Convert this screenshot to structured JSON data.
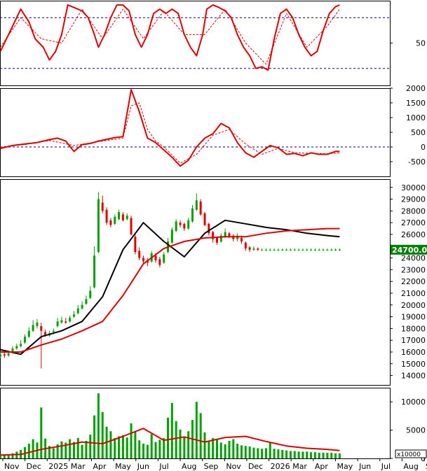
{
  "chart_data": [
    {
      "type": "line",
      "panel": "oscillator",
      "ytick_labels": [
        {
          "value": 50,
          "label": "50"
        }
      ],
      "ylim": [
        0,
        100
      ],
      "reference_levels": [
        80,
        20
      ],
      "series": [
        {
          "color": "#dd0000",
          "style": "solid",
          "x": [
            0,
            6,
            10,
            14,
            17,
            21,
            24,
            27,
            30,
            33,
            36,
            40,
            43,
            46,
            48,
            51,
            54,
            57,
            60,
            63,
            66,
            69,
            72,
            75,
            78,
            81,
            84,
            87,
            90,
            93,
            96,
            99,
            101,
            104,
            107,
            110,
            113,
            116,
            119,
            122,
            125,
            128,
            131,
            134,
            137,
            140,
            143,
            146,
            149,
            152,
            155,
            158,
            161,
            164,
            166
          ],
          "y": [
            40,
            70,
            90,
            75,
            55,
            45,
            30,
            40,
            60,
            95,
            92,
            88,
            80,
            60,
            45,
            60,
            80,
            95,
            95,
            88,
            60,
            45,
            60,
            85,
            90,
            85,
            90,
            85,
            60,
            45,
            35,
            60,
            90,
            95,
            92,
            88,
            80,
            60,
            45,
            35,
            20,
            22,
            18,
            55,
            85,
            90,
            80,
            60,
            45,
            35,
            40,
            65,
            85,
            93,
            95
          ]
        },
        {
          "color": "#dd0000",
          "style": "dashed",
          "x": [
            0,
            10,
            20,
            30,
            40,
            50,
            60,
            70,
            80,
            90,
            100,
            110,
            120,
            130,
            140,
            150,
            160,
            166
          ],
          "y": [
            45,
            80,
            55,
            50,
            90,
            55,
            90,
            55,
            88,
            60,
            60,
            90,
            50,
            25,
            85,
            45,
            70,
            90
          ]
        }
      ]
    },
    {
      "type": "line",
      "panel": "momentum",
      "ytick_labels": [
        {
          "value": 2000,
          "label": "2000"
        },
        {
          "value": 1500,
          "label": "1500"
        },
        {
          "value": 1000,
          "label": "1000"
        },
        {
          "value": 500,
          "label": "500"
        },
        {
          "value": 0,
          "label": "0"
        },
        {
          "value": -500,
          "label": "-500"
        }
      ],
      "ylim": [
        -1000,
        2000
      ],
      "reference_levels": [
        0
      ],
      "series": [
        {
          "color": "#dd0000",
          "style": "solid",
          "x": [
            0,
            6,
            12,
            18,
            24,
            28,
            32,
            36,
            40,
            44,
            48,
            52,
            56,
            60,
            64,
            68,
            72,
            76,
            80,
            84,
            88,
            92,
            96,
            100,
            104,
            108,
            112,
            116,
            120,
            124,
            128,
            132,
            136,
            140,
            144,
            148,
            152,
            156,
            160,
            164,
            166
          ],
          "y": [
            -50,
            50,
            100,
            150,
            250,
            300,
            200,
            -150,
            80,
            120,
            200,
            260,
            320,
            350,
            1950,
            1200,
            300,
            150,
            -100,
            -350,
            -650,
            -450,
            0,
            300,
            450,
            800,
            650,
            150,
            -200,
            -350,
            -150,
            50,
            -30,
            -250,
            -220,
            -300,
            -200,
            -250,
            -250,
            -150,
            -150
          ]
        },
        {
          "color": "#dd0000",
          "style": "dashed",
          "x": [
            0,
            12,
            24,
            36,
            48,
            60,
            64,
            68,
            72,
            76,
            80,
            88,
            96,
            104,
            112,
            120,
            128,
            136,
            144,
            152,
            160,
            166
          ],
          "y": [
            0,
            80,
            220,
            50,
            180,
            300,
            1400,
            1500,
            600,
            200,
            0,
            -550,
            -250,
            400,
            600,
            100,
            -250,
            -50,
            -200,
            -220,
            -230,
            -200
          ]
        }
      ]
    },
    {
      "type": "line",
      "panel": "price",
      "ytick_labels": [
        {
          "value": 30000,
          "label": "30000"
        },
        {
          "value": 29000,
          "label": "29000"
        },
        {
          "value": 28000,
          "label": "28000"
        },
        {
          "value": 27000,
          "label": "27000"
        },
        {
          "value": 26000,
          "label": "26000"
        },
        {
          "value": 24000,
          "label": "24000"
        },
        {
          "value": 23000,
          "label": "23000"
        },
        {
          "value": 22000,
          "label": "22000"
        },
        {
          "value": 21000,
          "label": "21000"
        },
        {
          "value": 20000,
          "label": "20000"
        },
        {
          "value": 19000,
          "label": "19000"
        },
        {
          "value": 18000,
          "label": "18000"
        },
        {
          "value": 17000,
          "label": "17000"
        },
        {
          "value": 16000,
          "label": "16000"
        },
        {
          "value": 15000,
          "label": "15000"
        },
        {
          "value": 14000,
          "label": "14000"
        }
      ],
      "last_price_label": "24700.00",
      "last_price": 24700,
      "ylim": [
        13200,
        30700
      ],
      "candles": {
        "up_color": "#00a000",
        "down_color": "#dd0000",
        "x": [
          0,
          2,
          4,
          6,
          8,
          10,
          12,
          14,
          16,
          18,
          20,
          22,
          24,
          26,
          28,
          30,
          32,
          34,
          36,
          38,
          40,
          42,
          44,
          46,
          48,
          50,
          52,
          54,
          56,
          58,
          60,
          62,
          64,
          66,
          68,
          70,
          72,
          74,
          76,
          78,
          80,
          82,
          84,
          86,
          88,
          90,
          92,
          94,
          96,
          98,
          100,
          102,
          104,
          106,
          108,
          110,
          112,
          114,
          116,
          118,
          120,
          122,
          124,
          126,
          128,
          130,
          132,
          134,
          136,
          138,
          140,
          142,
          144,
          146,
          148,
          150,
          152,
          154,
          156,
          158,
          160,
          162,
          164,
          166
        ],
        "close": [
          15800,
          15700,
          15900,
          16300,
          16500,
          16700,
          17300,
          17800,
          18300,
          18500,
          17800,
          17400,
          17600,
          17800,
          18600,
          18700,
          18500,
          18900,
          19200,
          19700,
          20000,
          20500,
          21200,
          24200,
          29000,
          28000,
          27000,
          26800,
          27500,
          27900,
          27200,
          27600,
          26000,
          24500,
          24000,
          23700,
          23600,
          24400,
          23800,
          23400,
          24300,
          25400,
          26400,
          27100,
          26800,
          26500,
          27200,
          28200,
          28900,
          27700,
          26800,
          26100,
          25600,
          25300,
          25900,
          26200,
          25800,
          25600,
          25900,
          25400,
          24800,
          24700,
          24800,
          24700,
          24700,
          24700,
          24700,
          24700,
          24700,
          24700,
          24700,
          24700,
          24700,
          24700,
          24700,
          24700,
          24700,
          24700,
          24700,
          24700,
          24700,
          24700,
          24700,
          24700
        ],
        "open": [
          15600,
          15800,
          15700,
          16000,
          16300,
          16500,
          16800,
          17300,
          17800,
          18200,
          18200,
          17700,
          17400,
          17700,
          18200,
          18500,
          18600,
          18600,
          19000,
          19300,
          19700,
          20100,
          20600,
          21500,
          24500,
          28700,
          28100,
          27200,
          26900,
          27300,
          27700,
          27300,
          27400,
          25800,
          24600,
          24000,
          23800,
          23700,
          24200,
          23900,
          23600,
          24500,
          25300,
          26300,
          27000,
          26900,
          26500,
          27100,
          28100,
          28800,
          27800,
          26900,
          26200,
          25700,
          25400,
          25800,
          26100,
          25900,
          25600,
          25700,
          25300,
          24900,
          24700,
          24800,
          24700,
          24700,
          24700,
          24700,
          24700,
          24700,
          24700,
          24700,
          24700,
          24700,
          24700,
          24700,
          24700,
          24700,
          24700,
          24700,
          24700,
          24700,
          24700,
          24700
        ],
        "high": [
          16000,
          16000,
          16100,
          16500,
          16700,
          17000,
          17500,
          18100,
          18700,
          18800,
          18500,
          17900,
          17800,
          18000,
          18900,
          19000,
          18900,
          19100,
          19500,
          20000,
          20300,
          20800,
          21600,
          25000,
          29600,
          29300,
          28300,
          27400,
          27700,
          28100,
          27900,
          27800,
          27600,
          26000,
          24900,
          24200,
          24000,
          24600,
          24400,
          24100,
          24500,
          25700,
          26600,
          27300,
          27200,
          27000,
          27400,
          28500,
          29500,
          29000,
          27900,
          27000,
          26300,
          25800,
          26100,
          26500,
          26200,
          26000,
          26100,
          25900,
          25400,
          25000,
          25000,
          24900,
          24800,
          24800,
          24800,
          24800,
          24800,
          24800,
          24800,
          24800,
          24800,
          24800,
          24800,
          24800,
          24800,
          24800,
          24800,
          24800,
          24800,
          24800,
          24800,
          24800
        ],
        "low": [
          15500,
          15500,
          15600,
          15900,
          16200,
          16400,
          16700,
          17200,
          17700,
          18000,
          14600,
          17300,
          17300,
          17500,
          18100,
          18400,
          18400,
          18500,
          18900,
          19200,
          19600,
          20000,
          20500,
          21400,
          24400,
          27800,
          26800,
          26600,
          26800,
          27200,
          27100,
          27200,
          25900,
          24300,
          23800,
          23500,
          23300,
          23600,
          23600,
          23200,
          23500,
          24400,
          25200,
          26200,
          26600,
          26300,
          26400,
          27000,
          28000,
          27600,
          26700,
          25900,
          25300,
          25100,
          25300,
          25700,
          25700,
          25400,
          25400,
          25200,
          24600,
          24500,
          24600,
          24600,
          24600,
          24600,
          24600,
          24600,
          24600,
          24600,
          24600,
          24600,
          24600,
          24600,
          24600,
          24600,
          24600,
          24600,
          24600,
          24600,
          24600,
          24600,
          24600,
          24600
        ]
      },
      "series": [
        {
          "color": "#000000",
          "style": "solid",
          "x": [
            0,
            10,
            20,
            30,
            40,
            50,
            60,
            70,
            80,
            90,
            100,
            110,
            120,
            130,
            140,
            150,
            160,
            166
          ],
          "y": [
            16200,
            15800,
            17300,
            17800,
            18600,
            20700,
            24700,
            27000,
            25400,
            24100,
            26100,
            27200,
            26900,
            26600,
            26400,
            26100,
            25900,
            25800
          ]
        },
        {
          "color": "#dd0000",
          "style": "solid",
          "x": [
            0,
            10,
            20,
            30,
            40,
            50,
            60,
            70,
            80,
            90,
            100,
            110,
            120,
            130,
            140,
            150,
            160,
            166
          ],
          "y": [
            16000,
            16000,
            16600,
            17100,
            17800,
            18600,
            20800,
            23500,
            24800,
            25400,
            25700,
            25800,
            25800,
            26100,
            26300,
            26400,
            26500,
            26500
          ]
        }
      ]
    },
    {
      "type": "bar",
      "panel": "volume",
      "ytick_labels": [
        {
          "value": 10000,
          "label": "10000"
        },
        {
          "value": 5000,
          "label": "5000"
        },
        {
          "value": 0,
          "label": "0"
        }
      ],
      "multiplier_label": "x10000",
      "ylim": [
        0,
        12500
      ],
      "bar_color": "#00a000",
      "x": [
        0,
        2,
        4,
        6,
        8,
        10,
        12,
        14,
        16,
        18,
        20,
        22,
        24,
        26,
        28,
        30,
        32,
        34,
        36,
        38,
        40,
        42,
        44,
        46,
        48,
        50,
        52,
        54,
        56,
        58,
        60,
        62,
        64,
        66,
        68,
        70,
        72,
        74,
        76,
        78,
        80,
        82,
        84,
        86,
        88,
        90,
        92,
        94,
        96,
        98,
        100,
        102,
        104,
        106,
        108,
        110,
        112,
        114,
        116,
        118,
        120,
        122,
        124,
        126,
        128,
        130,
        132,
        134,
        136,
        138,
        140,
        142,
        144,
        146,
        148,
        150,
        152,
        154,
        156,
        158,
        160,
        162,
        164,
        166
      ],
      "values": [
        800,
        600,
        700,
        900,
        1200,
        1500,
        2000,
        2600,
        3400,
        2800,
        9000,
        3500,
        2200,
        1800,
        2500,
        3000,
        2800,
        3400,
        2900,
        3600,
        2400,
        3100,
        4200,
        7600,
        11500,
        8200,
        5600,
        4800,
        3600,
        3900,
        4100,
        3700,
        6200,
        4800,
        3200,
        2600,
        2400,
        4300,
        2900,
        3300,
        3600,
        7200,
        9800,
        6600,
        5100,
        3700,
        4800,
        6800,
        10000,
        8000,
        4600,
        3100,
        3600,
        3400,
        2800,
        2500,
        3100,
        3400,
        2600,
        2300,
        2200,
        2100,
        1900,
        1800,
        1700,
        1800,
        2900,
        1700,
        1600,
        1500,
        1400,
        1300,
        1300,
        1200,
        1200,
        1200,
        1100,
        1100,
        1000,
        1000,
        1000,
        1000,
        900,
        900
      ],
      "series": [
        {
          "color": "#dd0000",
          "style": "solid",
          "x": [
            0,
            10,
            20,
            30,
            40,
            50,
            60,
            70,
            80,
            90,
            100,
            110,
            120,
            130,
            140,
            150,
            160,
            166
          ],
          "y": [
            600,
            700,
            1600,
            2200,
            2900,
            2600,
            3900,
            5300,
            3200,
            3800,
            2900,
            3700,
            3900,
            3000,
            2200,
            1800,
            1600,
            1400
          ]
        }
      ]
    },
    {
      "type": "bar",
      "panel": "time-axis",
      "x_tick_labels": [
        "Nov",
        "Dec",
        "2025",
        "Mar",
        "Apr",
        "May",
        "Jun",
        "Jul",
        "Aug",
        "Sep",
        "Nov",
        "Dec",
        "2026",
        "Mar",
        "Apr",
        "May",
        "Jun",
        "Jul",
        "Aug",
        "S"
      ]
    }
  ]
}
